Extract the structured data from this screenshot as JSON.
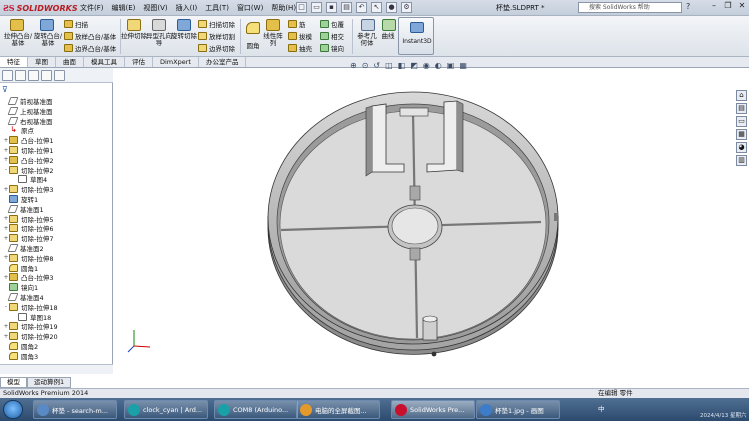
{
  "app": {
    "brand": "SOLIDWORKS",
    "document_title": "杯垫.SLDPRT *",
    "search_placeholder": "搜索 SolidWorks 帮助"
  },
  "menu": [
    "文件(F)",
    "编辑(E)",
    "视图(V)",
    "插入(I)",
    "工具(T)",
    "窗口(W)",
    "帮助(H)"
  ],
  "commands": {
    "extrude_boss": "拉伸凸台/基体",
    "revolve_boss": "旋转凸台/基体",
    "sweep": "扫描",
    "loft": "放样凸台/基体",
    "boundary_boss": "边界凸台/基体",
    "extrude_cut": "拉伸切除",
    "hole_wizard": "异型孔向导",
    "revolve_cut": "旋转切除",
    "swept_cut": "扫描切除",
    "lofted_cut": "放样切割",
    "boundary_cut": "边界切除",
    "fillet": "圆角",
    "linear_pattern": "线性阵列",
    "rib": "筋",
    "draft": "拔模",
    "shell": "抽壳",
    "wrap": "包覆",
    "intersect": "相交",
    "mirror": "镜向",
    "reference_geometry": "参考几何体",
    "curves": "曲线",
    "instant3d": "Instant3D"
  },
  "tabs": [
    "特征",
    "草图",
    "曲面",
    "模具工具",
    "评估",
    "DimXpert",
    "办公室产品"
  ],
  "active_tab": "特征",
  "tree": [
    {
      "label": "前视基准面",
      "icon": "plane",
      "expand": ""
    },
    {
      "label": "上视基准面",
      "icon": "plane",
      "expand": ""
    },
    {
      "label": "右视基准面",
      "icon": "plane",
      "expand": ""
    },
    {
      "label": "原点",
      "icon": "origin",
      "expand": ""
    },
    {
      "label": "凸台-拉伸1",
      "icon": "extrude",
      "expand": "+"
    },
    {
      "label": "切除-拉伸1",
      "icon": "cut",
      "expand": "+"
    },
    {
      "label": "凸台-拉伸2",
      "icon": "extrude",
      "expand": "+"
    },
    {
      "label": "切除-拉伸2",
      "icon": "cut",
      "expand": "-"
    },
    {
      "label": "草图4",
      "icon": "sketch",
      "expand": "",
      "indent": true
    },
    {
      "label": "切除-拉伸3",
      "icon": "cut",
      "expand": "+"
    },
    {
      "label": "旋转1",
      "icon": "revolve",
      "expand": ""
    },
    {
      "label": "基准面1",
      "icon": "plane",
      "expand": ""
    },
    {
      "label": "切除-拉伸5",
      "icon": "cut",
      "expand": "+"
    },
    {
      "label": "切除-拉伸6",
      "icon": "cut",
      "expand": "+"
    },
    {
      "label": "切除-拉伸7",
      "icon": "cut",
      "expand": "+"
    },
    {
      "label": "基准面2",
      "icon": "plane",
      "expand": ""
    },
    {
      "label": "切除-拉伸8",
      "icon": "cut",
      "expand": "+"
    },
    {
      "label": "圆角1",
      "icon": "fillet",
      "expand": ""
    },
    {
      "label": "凸台-拉伸3",
      "icon": "extrude",
      "expand": "+"
    },
    {
      "label": "镜向1",
      "icon": "mirror",
      "expand": ""
    },
    {
      "label": "基准面4",
      "icon": "plane",
      "expand": ""
    },
    {
      "label": "切除-拉伸18",
      "icon": "cut",
      "expand": "-"
    },
    {
      "label": "草图18",
      "icon": "sketch",
      "expand": "",
      "indent": true
    },
    {
      "label": "切除-拉伸19",
      "icon": "cut",
      "expand": "+"
    },
    {
      "label": "切除-拉伸20",
      "icon": "cut",
      "expand": "+"
    },
    {
      "label": "圆角2",
      "icon": "fillet",
      "expand": ""
    },
    {
      "label": "圆角3",
      "icon": "fillet",
      "expand": ""
    }
  ],
  "model_tabs": [
    "模型",
    "运动算例1"
  ],
  "status": {
    "left": "SolidWorks Premium 2014",
    "right": "在编辑 零件"
  },
  "taskbar": [
    {
      "label": "杯垫 - search-m...",
      "color": "#5a8ac6"
    },
    {
      "label": "clock_cyan | Ard...",
      "color": "#1aa1a8"
    },
    {
      "label": "COM8 (Arduino...",
      "color": "#1aa1a8"
    },
    {
      "label": "电脑的全屏截图...",
      "color": "#e39a2a"
    },
    {
      "label": "SolidWorks Pre...",
      "color": "#c8102e"
    },
    {
      "label": "杯垫1.jpg - 画图",
      "color": "#3d7cc9"
    }
  ],
  "tray": {
    "ime": "中",
    "clock": "2024/4/13 星期六"
  }
}
